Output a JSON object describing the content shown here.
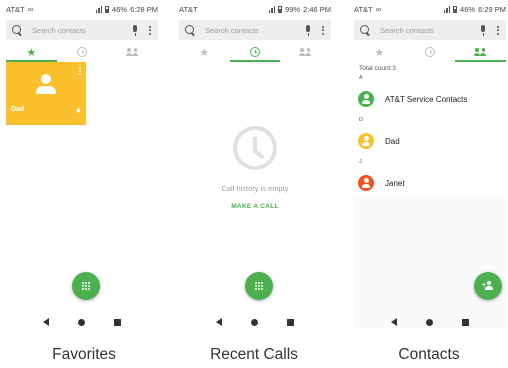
{
  "colors": {
    "accent": "#4caf50",
    "favorite_tile": "#fbc02d",
    "avatar_green": "#4caf50",
    "avatar_yellow": "#fbc02d",
    "avatar_red": "#f4511e"
  },
  "screens": [
    {
      "status": {
        "carrier": "AT&T",
        "loop_icon": "∞",
        "battery": "46%",
        "time": "6:28 PM"
      },
      "search": {
        "placeholder": "Search contacts"
      },
      "favorite": {
        "name": "Dad"
      },
      "caption": "Favorites"
    },
    {
      "status": {
        "carrier": "AT&T",
        "battery": "99%",
        "time": "2:46 PM"
      },
      "search": {
        "placeholder": "Search contacts"
      },
      "empty": {
        "message": "Call history is empty",
        "action": "MAKE A CALL"
      },
      "caption": "Recent Calls"
    },
    {
      "status": {
        "carrier": "AT&T",
        "loop_icon": "∞",
        "battery": "46%",
        "time": "6:29 PM"
      },
      "search": {
        "placeholder": "Search contacts"
      },
      "total": "Total count:3",
      "sections": [
        {
          "letter": "A",
          "name": "AT&T Service Contacts",
          "avatar_color": "#4caf50"
        },
        {
          "letter": "D",
          "name": "Dad",
          "avatar_color": "#fbc02d"
        },
        {
          "letter": "J",
          "name": "Janet",
          "avatar_color": "#f4511e"
        }
      ],
      "caption": "Contacts"
    }
  ],
  "icons": {
    "tab_favorites": "star-icon",
    "tab_recents": "clock-icon",
    "tab_contacts": "people-icon",
    "fab_dialer": "dialpad-icon",
    "fab_add_contact": "add-person-icon",
    "star_glyph": "★"
  }
}
